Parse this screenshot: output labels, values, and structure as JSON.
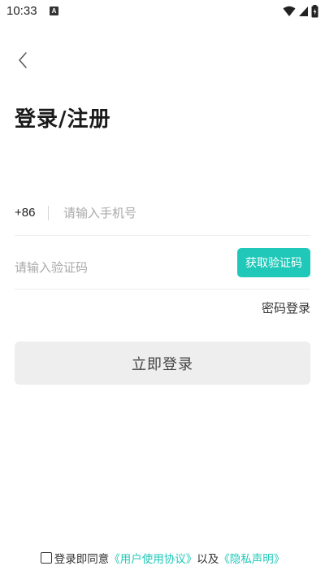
{
  "status_bar": {
    "time": "10:33",
    "badge": "A"
  },
  "header": {
    "title": "登录/注册"
  },
  "phone": {
    "country_code": "+86",
    "placeholder": "请输入手机号",
    "value": ""
  },
  "verify": {
    "placeholder": "请输入验证码",
    "value": "",
    "get_code_label": "获取验证码"
  },
  "password_login_label": "密码登录",
  "login_button_label": "立即登录",
  "agreement": {
    "checked": false,
    "prefix": "登录即同意",
    "user_agreement": "《用户使用协议》",
    "and": "以及",
    "privacy_policy": "《隐私声明》"
  },
  "colors": {
    "accent": "#1fc8b8",
    "button_disabled_bg": "#eeeeee",
    "divider": "#ececec"
  }
}
